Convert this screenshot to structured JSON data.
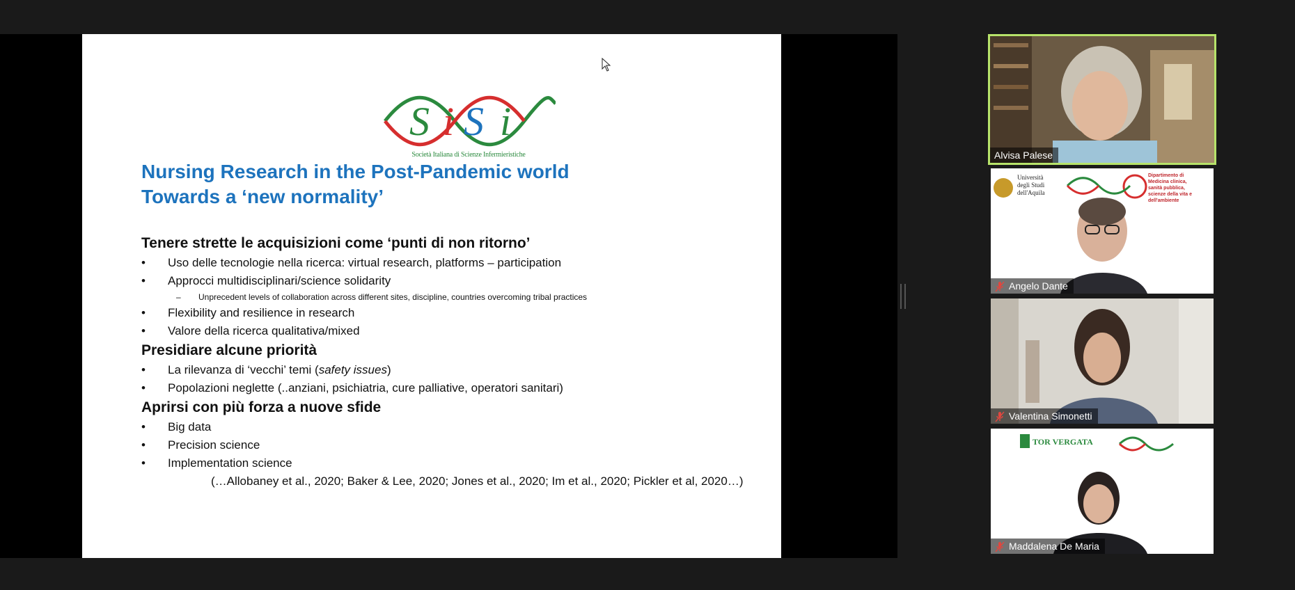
{
  "slide": {
    "logo": {
      "word": "SiSi",
      "subtitle": "Società Italiana di Scienze Infermieristiche"
    },
    "title_lines": [
      "Nursing Research in the Post-Pandemic world",
      "Towards a ‘new normality’"
    ],
    "section1": {
      "heading": "Tenere strette le acquisizioni come ‘punti di non ritorno’",
      "bullets": [
        "Uso delle tecnologie nella ricerca: virtual research, platforms – participation",
        "Approcci multidisciplinari/science solidarity"
      ],
      "sub_bullet": "Unprecedent levels of collaboration across different sites, discipline, countries overcoming tribal practices",
      "bullets_after": [
        "Flexibility and resilience in research",
        "Valore della ricerca qualitativa/mixed"
      ]
    },
    "section2": {
      "heading": "Presidiare alcune priorità",
      "bullet1_prefix": "La rilevanza di ‘vecchi’ temi (",
      "bullet1_italic": "safety issues",
      "bullet1_suffix": ")",
      "bullet2": "Popolazioni neglette (..anziani, psichiatria, cure palliative, operatori sanitari)"
    },
    "section3": {
      "heading": "Aprirsi con più forza a nuove sfide",
      "bullets": [
        "Big data",
        "Precision science",
        "Implementation science"
      ],
      "refs": "(…Allobaney et al., 2020; Baker & Lee, 2020; Jones et al., 2020; Im et al., 2020; Pickler et al, 2020…)"
    },
    "bullet_glyph": "•",
    "dash_glyph": "–"
  },
  "participants": [
    {
      "name": "Alvisa Palese",
      "active": true,
      "muted": false
    },
    {
      "name": "Angelo Dante",
      "active": false,
      "muted": true,
      "banner": [
        "Università",
        "degli Studi",
        "dell'Aquila"
      ],
      "banner_right": [
        "Dipartimento di",
        "Medicina clinica,",
        "sanità pubblica,",
        "scienze della vita e dell'ambiente"
      ]
    },
    {
      "name": "Valentina Simonetti",
      "active": false,
      "muted": true
    },
    {
      "name": "Maddalena De Maria",
      "active": false,
      "muted": true,
      "banner": [
        "TOR VERGATA"
      ]
    }
  ],
  "colors": {
    "title": "#1d73bd",
    "active_border": "#b7e36a",
    "mute_icon": "#e0473f",
    "logo_green": "#2b8a3e",
    "logo_red": "#d62e2e",
    "logo_blue": "#1d73bd"
  }
}
